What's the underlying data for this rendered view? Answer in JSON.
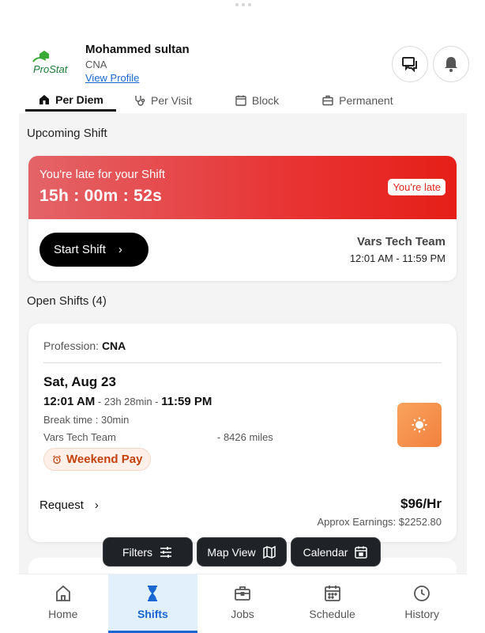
{
  "header": {
    "logo_text": "ProStat",
    "user_name": "Mohammed sultan",
    "user_role": "CNA",
    "view_profile": "View Profile"
  },
  "tabs": [
    {
      "label": "Per Diem",
      "icon": "home-icon",
      "active": true
    },
    {
      "label": "Per Visit",
      "icon": "stethoscope-icon",
      "active": false
    },
    {
      "label": "Block",
      "icon": "calendar-icon",
      "active": false
    },
    {
      "label": "Permanent",
      "icon": "briefcase-icon",
      "active": false
    }
  ],
  "upcoming": {
    "section_title": "Upcoming Shift",
    "late_title": "You're late for your Shift",
    "timer": "15h : 00m : 52s",
    "late_badge": "You're late",
    "start_button": "Start Shift",
    "team_name": "Vars Tech Team",
    "time_range": "12:01 AM - 11:59 PM"
  },
  "open_shifts": {
    "section_title": "Open Shifts (4)",
    "items": [
      {
        "profession_label": "Profession:",
        "profession": "CNA",
        "date": "Sat, Aug 23",
        "start_time": "12:01 AM",
        "duration": " - 23h 28min - ",
        "end_time": "11:59 PM",
        "break_time": "Break time : 30min",
        "facility": "Vars Tech Team",
        "distance": "- 8426 miles",
        "badge": "Weekend Pay",
        "shift_icon": "sun-icon",
        "request": "Request",
        "pay_rate": "$96/Hr",
        "earnings": "Approx Earnings: $2252.80"
      }
    ]
  },
  "actions": {
    "filters": "Filters",
    "map_view": "Map View",
    "calendar": "Calendar"
  },
  "bottom_nav": [
    {
      "label": "Home",
      "icon": "home-icon",
      "active": false
    },
    {
      "label": "Shifts",
      "icon": "hourglass-icon",
      "active": true
    },
    {
      "label": "Jobs",
      "icon": "briefcase-icon",
      "active": false
    },
    {
      "label": "Schedule",
      "icon": "calendar-icon",
      "active": false
    },
    {
      "label": "History",
      "icon": "clock-icon",
      "active": false
    }
  ],
  "colors": {
    "accent": "#1a66d2",
    "late_red": "#e83434",
    "weekend_orange": "#c2410c"
  }
}
